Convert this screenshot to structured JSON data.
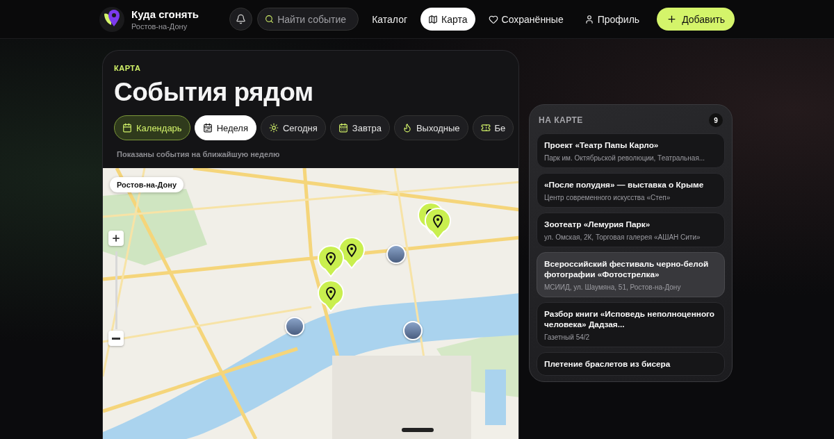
{
  "brand": {
    "title": "Куда сгонять",
    "city": "Ростов-на-Дону"
  },
  "nav": {
    "search_placeholder": "Найти событие",
    "links": [
      {
        "label": "Каталог",
        "selected": false
      },
      {
        "label": "Карта",
        "selected": true
      },
      {
        "label": "Сохранённые",
        "selected": false
      },
      {
        "label": "Профиль",
        "selected": false
      }
    ],
    "add_button": "Добавить"
  },
  "card": {
    "eyebrow": "КАРТА",
    "title": "События рядом",
    "calendar_toggle": {
      "label": "Календарь",
      "on": true
    },
    "filters": [
      {
        "label": "Неделя",
        "selected": true
      },
      {
        "label": "Сегодня",
        "selected": false
      },
      {
        "label": "Завтра",
        "selected": false
      },
      {
        "label": "Выходные",
        "selected": false
      },
      {
        "label": "Бе",
        "selected": false
      }
    ],
    "caption": "Показаны события на ближайшую неделю",
    "map": {
      "kind": "picture",
      "city_badge": "Ростов-на-Дону"
    }
  },
  "panel": {
    "title": "НА КАРТЕ",
    "count": "9",
    "events": [
      {
        "title": "Проект «Театр Папы Карло»",
        "place": "Парк им. Октябрьской революции, Театральная...",
        "selected": false
      },
      {
        "title": "«После полудня» — выставка о Крыме",
        "place": "Центр современного искусства «Степ»",
        "selected": false
      },
      {
        "title": "Зоотеатр «Лемурия Парк»",
        "place": "ул. Омская, 2К, Торговая галерея «АШАН Сити»",
        "selected": false
      },
      {
        "title": "Всероссийский фестиваль черно-белой фотографии «Фотострелка»",
        "place": "МСИИД, ул. Шаумяна, 51, Ростов-на-Дону",
        "selected": true
      },
      {
        "title": "Разбор книги «Исповедь неполноценного человека» Дадзая...",
        "place": "Газетный 54/2",
        "selected": false
      },
      {
        "title": "Плетение браслетов из бисера",
        "selected": false
      }
    ]
  }
}
